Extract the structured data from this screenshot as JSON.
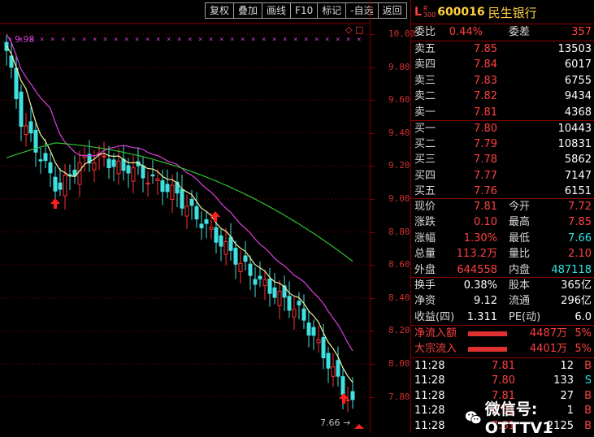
{
  "toolbar": [
    "复权",
    "叠加",
    "画线",
    "F10",
    "标记",
    "-自选",
    "返回"
  ],
  "chart": {
    "price_ticks": [
      "10.00",
      "9.80",
      "9.60",
      "9.40",
      "9.20",
      "9.00",
      "8.80",
      "8.60",
      "8.40",
      "8.20",
      "8.00",
      "7.80"
    ],
    "high_label": "9.98",
    "low_label": "7.66",
    "top_marker": "◇ □"
  },
  "quote": {
    "prefix_l": "L",
    "prefix_r": "R",
    "prefix_300": "300",
    "code": "600016",
    "name": "民生银行",
    "weibi_label": "委比",
    "weibi": "0.44%",
    "weicha_label": "委差",
    "weicha": "357",
    "asks": [
      {
        "label": "卖五",
        "price": "7.85",
        "vol": "13503"
      },
      {
        "label": "卖四",
        "price": "7.84",
        "vol": "6017"
      },
      {
        "label": "卖三",
        "price": "7.83",
        "vol": "6755"
      },
      {
        "label": "卖二",
        "price": "7.82",
        "vol": "9434"
      },
      {
        "label": "卖一",
        "price": "7.81",
        "vol": "4368"
      }
    ],
    "bids": [
      {
        "label": "买一",
        "price": "7.80",
        "vol": "10443"
      },
      {
        "label": "买二",
        "price": "7.79",
        "vol": "10831"
      },
      {
        "label": "买三",
        "price": "7.78",
        "vol": "5862"
      },
      {
        "label": "买四",
        "price": "7.77",
        "vol": "7147"
      },
      {
        "label": "买五",
        "price": "7.76",
        "vol": "6151"
      }
    ],
    "stats": [
      {
        "l1": "现价",
        "v1": "7.81",
        "l2": "今开",
        "v2": "7.72"
      },
      {
        "l1": "涨跌",
        "v1": "0.10",
        "l2": "最高",
        "v2": "7.85"
      },
      {
        "l1": "涨幅",
        "v1": "1.30%",
        "l2": "最低",
        "v2": "7.66"
      },
      {
        "l1": "总量",
        "v1": "113.2万",
        "l2": "量比",
        "v2": "2.10"
      },
      {
        "l1": "外盘",
        "v1": "644558",
        "l2": "内盘",
        "v2": "487118"
      }
    ],
    "finance": [
      {
        "l1": "换手",
        "v1": "0.38%",
        "l2": "股本",
        "v2": "365亿"
      },
      {
        "l1": "净资",
        "v1": "9.12",
        "l2": "流通",
        "v2": "296亿"
      },
      {
        "l1": "收益(四)",
        "v1": "1.311",
        "l2": "PE(动)",
        "v2": "6.0"
      }
    ],
    "flows": [
      {
        "label": "净流入额",
        "value": "4487万",
        "pct": "5%"
      },
      {
        "label": "大宗流入",
        "value": "4401万",
        "pct": "5%"
      }
    ],
    "ticks": [
      {
        "time": "11:28",
        "price": "7.81",
        "vol": "12",
        "side": "B"
      },
      {
        "time": "11:28",
        "price": "7.80",
        "vol": "133",
        "side": "S"
      },
      {
        "time": "11:28",
        "price": "7.81",
        "vol": "27",
        "side": "B"
      },
      {
        "time": "11:28",
        "price": "7.81",
        "vol": "1",
        "side": "B"
      },
      {
        "time": "11:28",
        "price": "7.81",
        "vol": "2125",
        "side": "B"
      }
    ]
  },
  "watermark": "微信号: OTTTV1"
}
